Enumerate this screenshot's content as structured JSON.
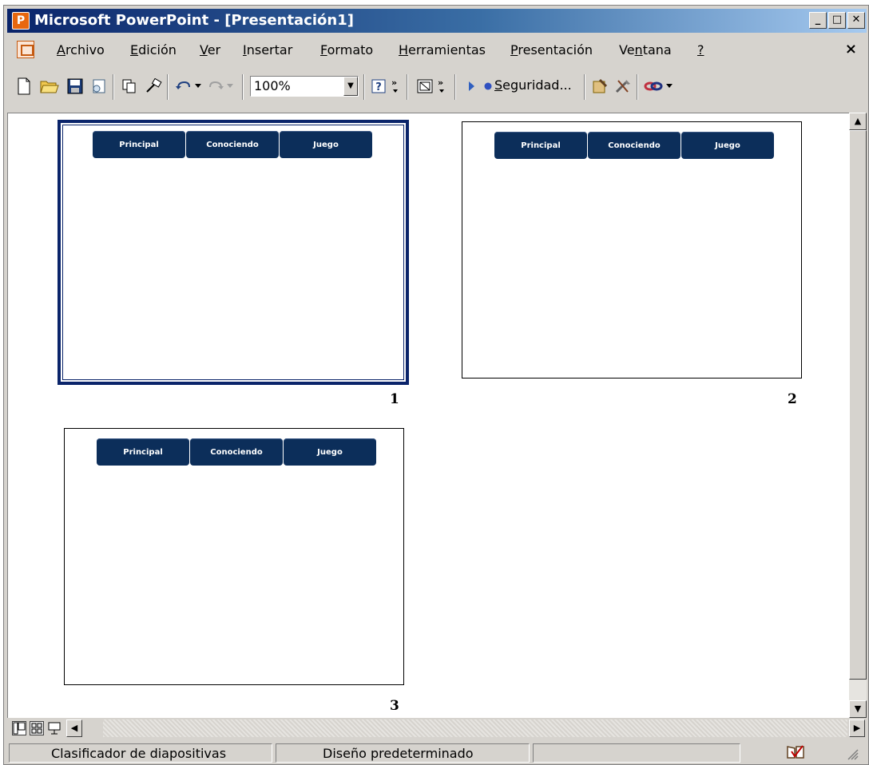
{
  "window": {
    "title": "Microsoft PowerPoint - [Presentación1]",
    "app_icon": "powerpoint-icon",
    "controls": [
      "minimize",
      "maximize",
      "close"
    ]
  },
  "menu": {
    "items": [
      {
        "label": "Archivo",
        "underline": "A",
        "rest": "rchivo"
      },
      {
        "label": "Edición",
        "underline": "E",
        "rest": "dición"
      },
      {
        "label": "Ver",
        "underline": "V",
        "rest": "er"
      },
      {
        "label": "Insertar",
        "underline": "I",
        "rest": "nsertar"
      },
      {
        "label": "Formato",
        "underline": "F",
        "rest": "ormato"
      },
      {
        "label": "Herramientas",
        "underline": "H",
        "rest": "erramientas"
      },
      {
        "label": "Presentación",
        "underline": "P",
        "rest": "resentación"
      },
      {
        "label": "Ventana",
        "pre": "Ve",
        "underline": "n",
        "rest": "tana"
      },
      {
        "label": "?",
        "underline": "?",
        "rest": ""
      }
    ],
    "close_label": "×"
  },
  "toolbar": {
    "zoom_value": "100%",
    "seguridad_label": "Seguridad...",
    "seguridad_underline": "S",
    "seguridad_rest": "eguridad..."
  },
  "slides": [
    {
      "number": "1",
      "buttons": [
        "Principal",
        "Conociendo",
        "Juego"
      ],
      "selected": true
    },
    {
      "number": "2",
      "buttons": [
        "Principal",
        "Conociendo",
        "Juego"
      ],
      "selected": false
    },
    {
      "number": "3",
      "buttons": [
        "Principal",
        "Conociendo",
        "Juego"
      ],
      "selected": false
    }
  ],
  "status": {
    "view": "Clasificador de diapositivas",
    "design": "Diseño predeterminado"
  },
  "colors": {
    "nav_button": "#0c2e5a",
    "selection_border": "#0a246a",
    "chrome": "#d6d3ce"
  }
}
